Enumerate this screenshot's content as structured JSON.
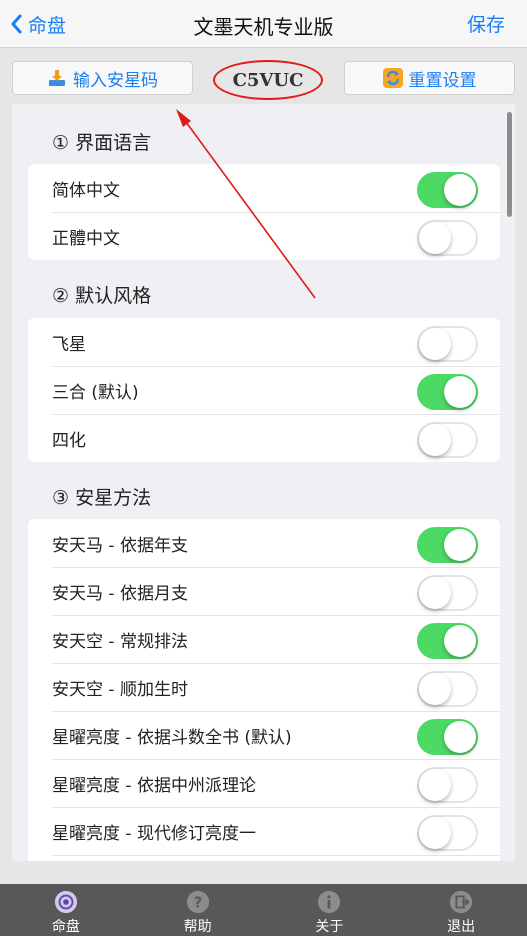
{
  "nav": {
    "back_label": "命盘",
    "title": "文墨天机专业版",
    "save_label": "保存"
  },
  "toolbar": {
    "input_code_label": "输入安星码",
    "reset_label": "重置设置",
    "code": "C5VUC"
  },
  "sections": [
    {
      "title": "① 界面语言",
      "items": [
        {
          "label": "简体中文",
          "on": true
        },
        {
          "label": "正體中文",
          "on": false
        }
      ]
    },
    {
      "title": "② 默认风格",
      "items": [
        {
          "label": "飞星",
          "on": false
        },
        {
          "label": "三合 (默认)",
          "on": true
        },
        {
          "label": "四化",
          "on": false
        }
      ]
    },
    {
      "title": "③ 安星方法",
      "items": [
        {
          "label": "安天马 - 依据年支",
          "on": true
        },
        {
          "label": "安天马 - 依据月支",
          "on": false
        },
        {
          "label": "安天空 - 常规排法",
          "on": true
        },
        {
          "label": "安天空 - 顺加生时",
          "on": false
        },
        {
          "label": "星曜亮度 - 依据斗数全书 (默认)",
          "on": true
        },
        {
          "label": "星曜亮度 - 依据中州派理论",
          "on": false
        },
        {
          "label": "星曜亮度 - 现代修订亮度一",
          "on": false
        }
      ]
    }
  ],
  "tabbar": [
    {
      "label": "命盘",
      "icon": "chart-disc-icon"
    },
    {
      "label": "帮助",
      "icon": "help-icon"
    },
    {
      "label": "关于",
      "icon": "info-icon"
    },
    {
      "label": "退出",
      "icon": "exit-icon"
    }
  ],
  "colors": {
    "accent": "#1a7ef5",
    "switch_on": "#4cd964",
    "annotation": "#e01a1a",
    "tabbar": "#585858"
  }
}
